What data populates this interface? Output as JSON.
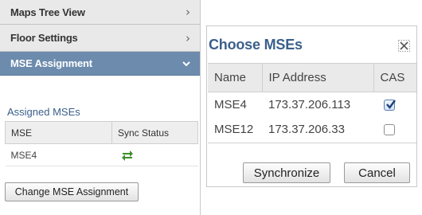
{
  "left_panel": {
    "sections": [
      {
        "label": "Maps Tree View",
        "chevron": ">",
        "expanded": false
      },
      {
        "label": "Floor Settings",
        "chevron": ">",
        "expanded": false
      },
      {
        "label": "MSE Assignment",
        "chevron": "v",
        "expanded": true
      }
    ],
    "assigned_title": "Assigned MSEs",
    "table": {
      "columns": [
        "MSE",
        "Sync Status"
      ],
      "rows": [
        {
          "mse": "MSE4",
          "sync_icon": "sync-arrows-icon"
        }
      ]
    },
    "change_button": "Change MSE Assignment"
  },
  "dialog": {
    "title": "Choose MSEs",
    "close_icon": "close-icon",
    "columns": [
      "Name",
      "IP Address",
      "CAS"
    ],
    "rows": [
      {
        "name": "MSE4",
        "ip": "173.37.206.113",
        "cas_checked": true
      },
      {
        "name": "MSE12",
        "ip": "173.37.206.33",
        "cas_checked": false
      }
    ],
    "buttons": {
      "synchronize": "Synchronize",
      "cancel": "Cancel"
    }
  },
  "colors": {
    "active_header": "#6c8bad",
    "title_blue": "#3a5f8c",
    "sync_icon_green": "#3f8f2a"
  }
}
